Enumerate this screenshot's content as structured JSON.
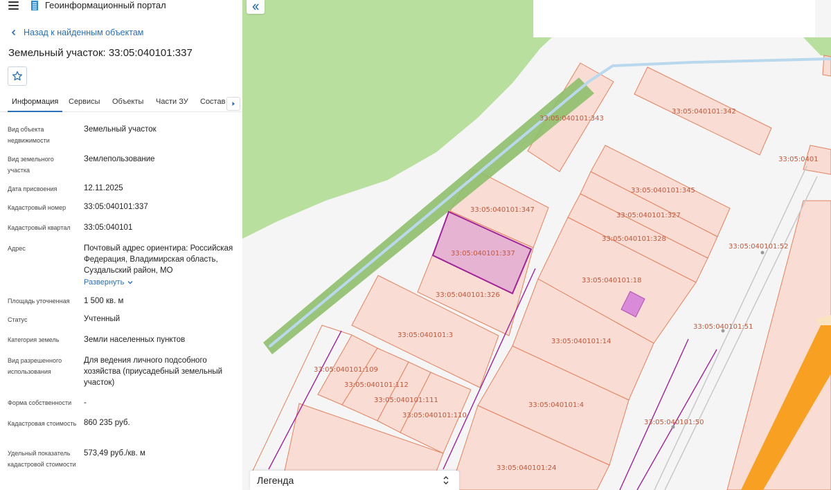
{
  "header": {
    "portal_title": "Геоинформационный портал"
  },
  "nav": {
    "back_label": "Назад к найденным объектам"
  },
  "object": {
    "title": "Земельный участок: 33:05:040101:337"
  },
  "tabs": [
    {
      "label": "Информация",
      "active": true
    },
    {
      "label": "Сервисы"
    },
    {
      "label": "Объекты"
    },
    {
      "label": "Части ЗУ"
    },
    {
      "label": "Состав"
    }
  ],
  "info": [
    {
      "label": "Вид объекта недвижимости",
      "value": "Земельный участок"
    },
    {
      "label": "Вид земельного участка",
      "value": "Землепользование"
    },
    {
      "label": "Дата присвоения",
      "value": "12.11.2025"
    },
    {
      "label": "Кадастровый номер",
      "value": "33:05:040101:337"
    },
    {
      "label": "Кадастровый квартал",
      "value": "33:05:040101"
    },
    {
      "label": "Адрес",
      "value": "Почтовый адрес ориентира: Российская Федерация, Владимирская область, Суздальский район, МО"
    },
    {
      "label": "Площадь уточненная",
      "value": "1 500 кв. м"
    },
    {
      "label": "Статус",
      "value": "Учтенный"
    },
    {
      "label": "Категория земель",
      "value": "Земли населенных пунктов"
    },
    {
      "label": "Вид разрешенного использования",
      "value": "Для ведения личного подсобного хозяйства (приусадебный земельный участок)"
    },
    {
      "label": "Форма собственности",
      "value": "-"
    },
    {
      "label": "Кадастровая стоимость",
      "value": "860 235 руб."
    },
    {
      "label": "Удельный показатель кадастровой стоимости",
      "value": "573,49 руб./кв. м"
    }
  ],
  "expand_label": "Развернуть",
  "map": {
    "parcel_labels": [
      "33:05:040101:343",
      "33:05:040101:342",
      "33:05:0401",
      "33:05:040101:345",
      "33:05:040101:347",
      "33:05:040101:327",
      "33:05:040101:328",
      "33:05:040101:52",
      "33:05:040101:337",
      "33:05:040101:18",
      "33:05:040101:326",
      "33:05:040101:3",
      "33:05:040101:51",
      "33:05:040101:14",
      "33:05:040101:109",
      "33:05:040101:112",
      "33:05:040101:111",
      "33:05:040101:110",
      "33:05:040101:4",
      "33:05:040101:50",
      "33:05:040101:24"
    ],
    "colors": {
      "background": "#f5f5f5",
      "forest": "#b9df9f",
      "parcel_fill": "#f9dcd3",
      "parcel_stroke": "#e3825f",
      "selected_fill": "#e6b3d3",
      "selected_stroke": "#a0239a",
      "water": "#b9d8ee",
      "green_strip": "#8fbf6b",
      "road": "#f7a022",
      "label": "#c0583c"
    }
  },
  "legend": {
    "label": "Легенда"
  }
}
